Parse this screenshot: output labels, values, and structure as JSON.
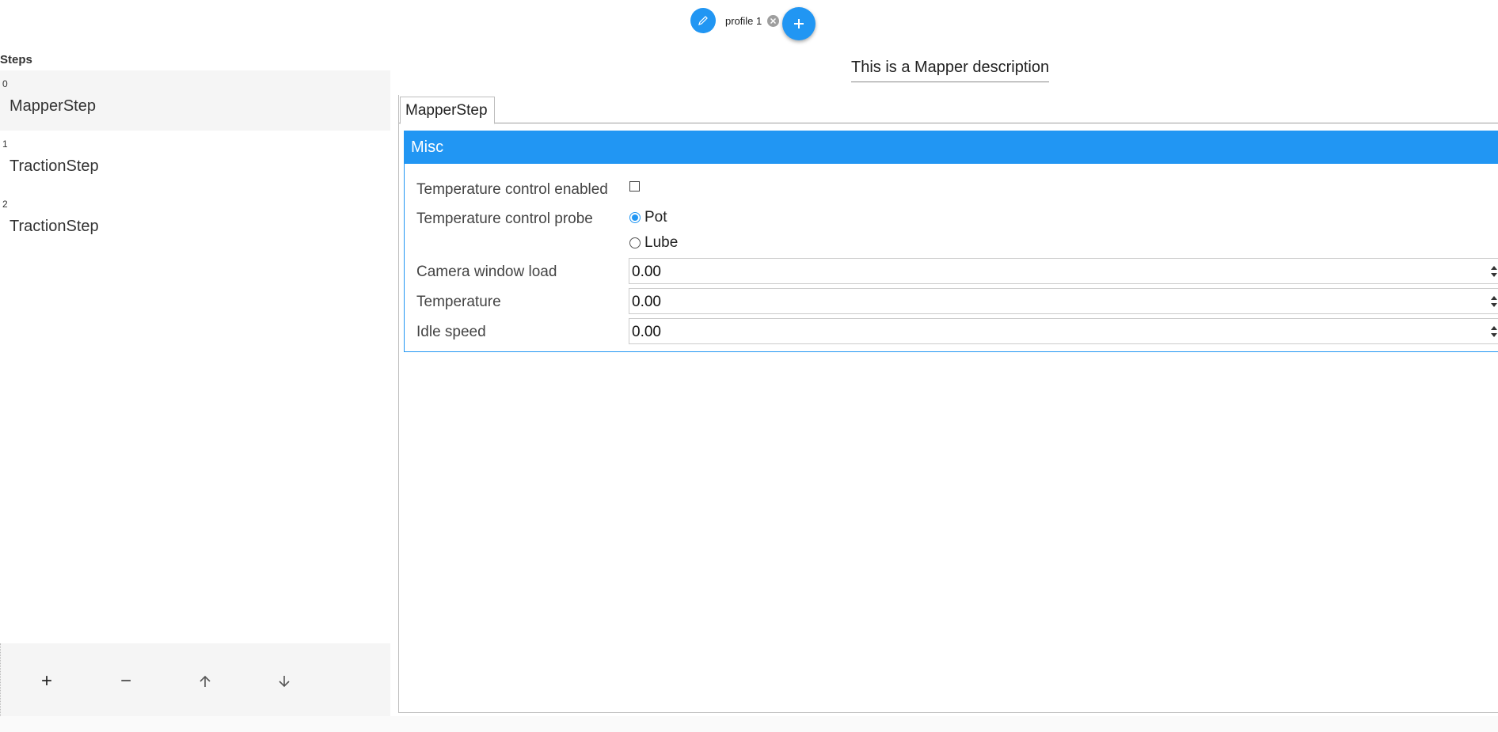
{
  "profiles": {
    "items": [
      {
        "label": "profile 1",
        "icon": "edit-icon"
      }
    ],
    "add_icon": "plus-icon",
    "close_icon": "close-icon"
  },
  "steps": {
    "title": "Steps",
    "items": [
      {
        "index": "0",
        "label": "MapperStep"
      },
      {
        "index": "1",
        "label": "TractionStep"
      },
      {
        "index": "2",
        "label": "TractionStep"
      }
    ],
    "selected_index": 0,
    "toolbar": {
      "add_label": "+",
      "remove_label": "−",
      "up_icon": "arrow-up-icon",
      "down_icon": "arrow-down-icon"
    }
  },
  "main": {
    "description": "This is a Mapper description",
    "tabs": [
      {
        "label": "MapperStep"
      }
    ],
    "section": {
      "title": "Misc",
      "fields": {
        "temp_control_enabled": {
          "label": "Temperature control enabled",
          "checked": false
        },
        "temp_control_probe": {
          "label": "Temperature control probe",
          "options": [
            "Pot",
            "Lube"
          ],
          "selected": "Pot"
        },
        "camera_window_load": {
          "label": "Camera window load",
          "value": "0.00"
        },
        "temperature": {
          "label": "Temperature",
          "value": "0.00"
        },
        "idle_speed": {
          "label": "Idle speed",
          "value": "0.00"
        }
      }
    }
  },
  "colors": {
    "accent": "#2196f3",
    "panel": "#f5f5f5"
  }
}
